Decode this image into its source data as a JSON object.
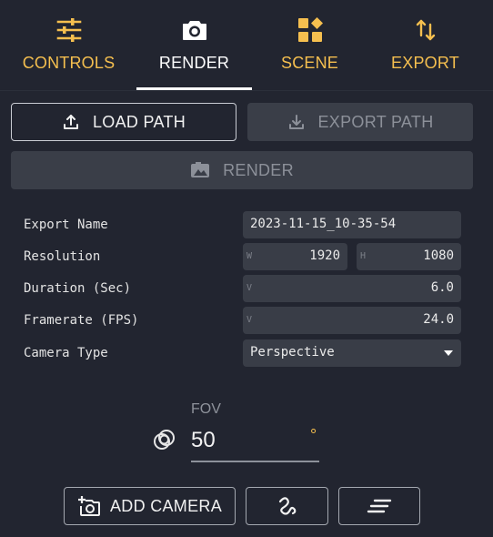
{
  "tabs": [
    {
      "label": "CONTROLS",
      "icon": "sliders-icon",
      "active": false
    },
    {
      "label": "RENDER",
      "icon": "camera-icon",
      "active": true
    },
    {
      "label": "SCENE",
      "icon": "widgets-icon",
      "active": false
    },
    {
      "label": "EXPORT",
      "icon": "swap-vertical-icon",
      "active": false
    }
  ],
  "buttons": {
    "load_path": "LOAD PATH",
    "export_path": "EXPORT PATH",
    "render": "RENDER",
    "add_camera": "ADD CAMERA"
  },
  "form": {
    "export_name": {
      "label": "Export Name",
      "value": "2023-11-15_10-35-54"
    },
    "resolution": {
      "label": "Resolution",
      "w_prefix": "W",
      "w": "1920",
      "h_prefix": "H",
      "h": "1080"
    },
    "duration": {
      "label": "Duration (Sec)",
      "prefix": "V",
      "value": "6.0"
    },
    "framerate": {
      "label": "Framerate (FPS)",
      "prefix": "V",
      "value": "24.0"
    },
    "camera_type": {
      "label": "Camera Type",
      "value": "Perspective"
    }
  },
  "fov": {
    "label": "FOV",
    "value": "50",
    "unit": "°"
  },
  "colors": {
    "background": "#222530",
    "accent": "#f5bf4f",
    "field": "#393d47",
    "disabled": "#3a3e48"
  }
}
